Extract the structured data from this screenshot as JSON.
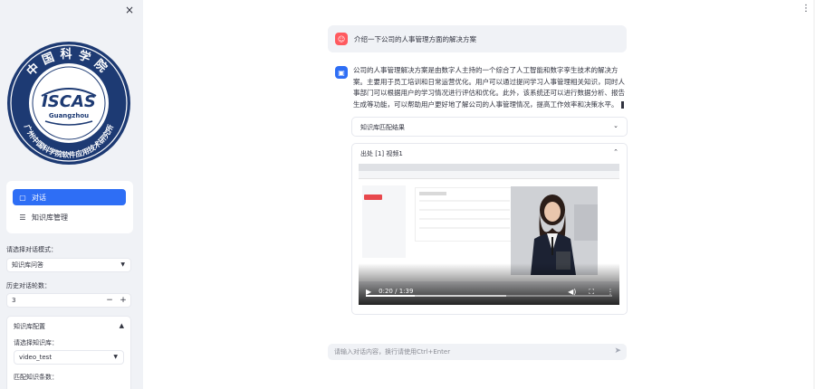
{
  "sidebar": {
    "close_label": "×",
    "logo": {
      "top_text": "中国科学院",
      "center_text": "ISCAS",
      "city_text": "Guangzhou",
      "bottom_text": "广州中国科学院软件应用技术研究所"
    },
    "nav": [
      {
        "label": "对话",
        "icon": "chat-bubble-icon",
        "active": true
      },
      {
        "label": "知识库管理",
        "icon": "list-icon",
        "active": false
      }
    ],
    "mode_label": "请选择对话模式：",
    "mode_value": "知识库问答",
    "history_label": "历史对话轮数：",
    "history_value": "3",
    "minus_label": "−",
    "plus_label": "+",
    "kb_settings_label": "知识库配置",
    "kb_select_label": "请选择知识库：",
    "kb_select_value": "video_test",
    "match_label": "匹配知识条数："
  },
  "main": {
    "menu_label": "⋮",
    "user_message": "介绍一下公司的人事管理方面的解决方案",
    "bot_message": "公司的人事管理解决方案是由数字人主持的一个综合了人工智能和数字孪生技术的解决方案。主要用于员工培训和日常运营优化。用户可以通过提问学习人事管理相关知识，同时人事部门可以根据用户的学习情况进行评估和优化。此外，该系统还可以进行数据分析、报告生成等功能，可以帮助用户更好地了解公司的人事管理情况，提高工作效率和决策水平。",
    "card1_title": "知识库匹配结果",
    "card2_title": "出处 [1] 视频1",
    "video": {
      "current_time": "0:20",
      "duration": "1:39",
      "progress": 0.2,
      "buffered": 0.57
    },
    "input_placeholder": "请输入对话内容，换行请使用Ctrl+Enter"
  },
  "colors": {
    "accent": "#2e6ef5",
    "user_avatar": "#ff5a5f",
    "sidebar_bg": "#f0f2f6"
  }
}
